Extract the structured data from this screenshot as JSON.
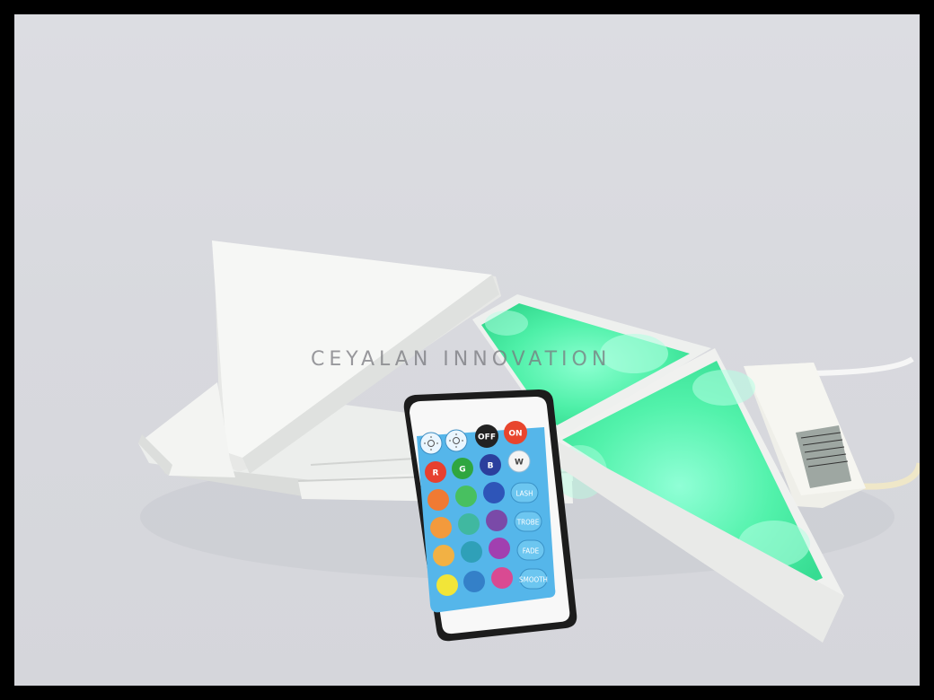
{
  "watermark": "CEYALAN INNOVATION",
  "remote": {
    "top_buttons": {
      "brightness_up_icon": "sun-icon",
      "brightness_down_icon": "sun-icon",
      "off_label": "OFF",
      "on_label": "ON"
    },
    "color_letters": {
      "r": "R",
      "g": "G",
      "b": "B",
      "w": "W"
    },
    "mode_buttons": {
      "flash": "LASH",
      "strobe": "TROBE",
      "fade": "FADE",
      "smooth": "SMOOTH"
    }
  },
  "colors": {
    "panel_glow": "#4ef0a8",
    "panel_white": "#f3f4f2",
    "remote_blue": "#55b6ea",
    "off_button": "#222222",
    "on_button": "#e8452d"
  }
}
